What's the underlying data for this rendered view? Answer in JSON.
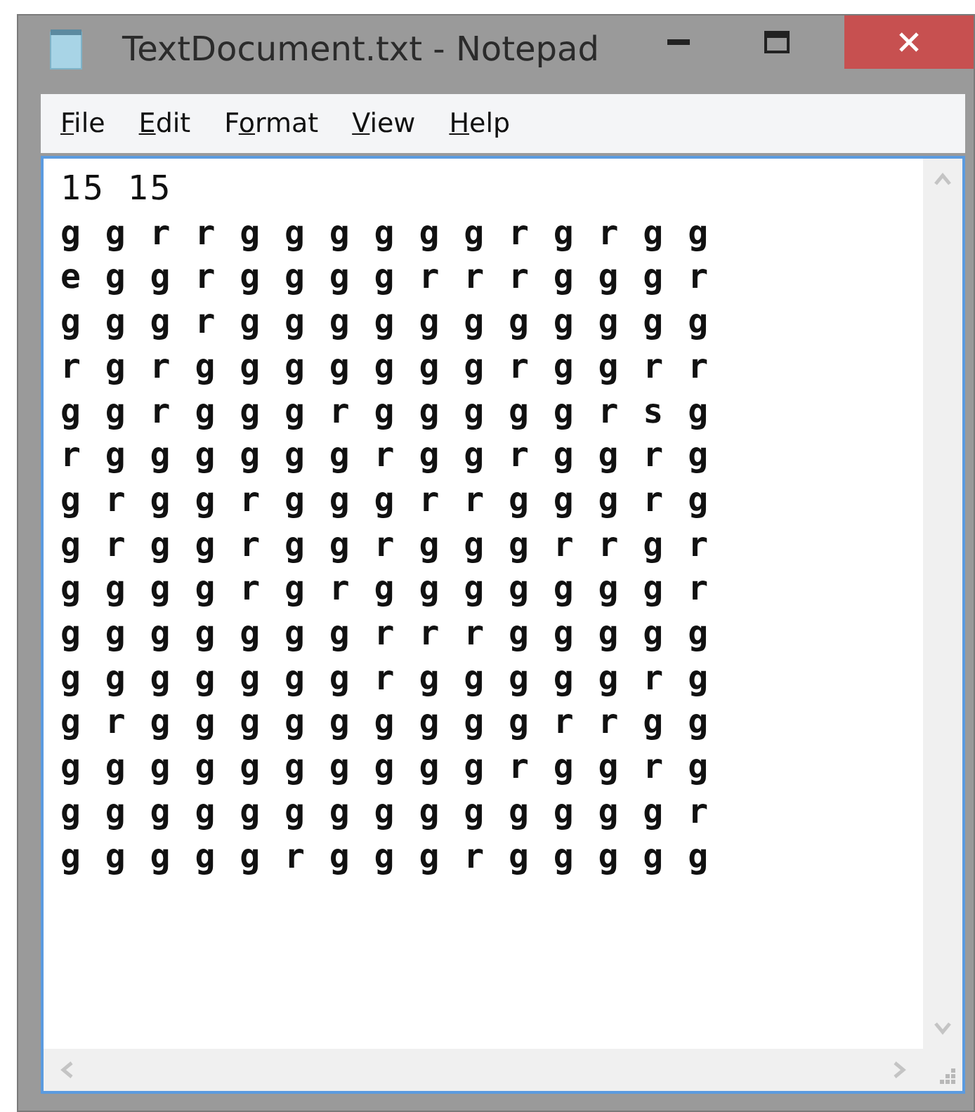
{
  "window": {
    "title": "TextDocument.txt - Notepad"
  },
  "menu": [
    {
      "parts": [
        {
          "text": "F",
          "underlined": true
        },
        {
          "text": "ile",
          "underlined": false
        }
      ]
    },
    {
      "parts": [
        {
          "text": "E",
          "underlined": true
        },
        {
          "text": "dit",
          "underlined": false
        }
      ]
    },
    {
      "parts": [
        {
          "text": "F",
          "underlined": false
        },
        {
          "text": "o",
          "underlined": true
        },
        {
          "text": "rmat",
          "underlined": false
        }
      ]
    },
    {
      "parts": [
        {
          "text": "V",
          "underlined": true
        },
        {
          "text": "iew",
          "underlined": false
        }
      ]
    },
    {
      "parts": [
        {
          "text": "H",
          "underlined": true
        },
        {
          "text": "elp",
          "underlined": false
        }
      ]
    }
  ],
  "document": {
    "lines": [
      "15 15",
      "g g r r g g g g g g r g r g g",
      "e g g r g g g g r r r g g g r",
      "g g g r g g g g g g g g g g g",
      "r g r g g g g g g g r g g r r",
      "g g r g g g r g g g g g r s g",
      "r g g g g g g r g g r g g r g",
      "g r g g r g g g r r g g g r g",
      "g r g g r g g r g g g r r g r",
      "g g g g r g r g g g g g g g r",
      "g g g g g g g r r r g g g g g",
      "g g g g g g g r g g g g g r g",
      "g r g g g g g g g g g r r g g",
      "g g g g g g g g g g r g g r g",
      "g g g g g g g g g g g g g g r",
      "g g g g g r g g g r g g g g g"
    ]
  }
}
